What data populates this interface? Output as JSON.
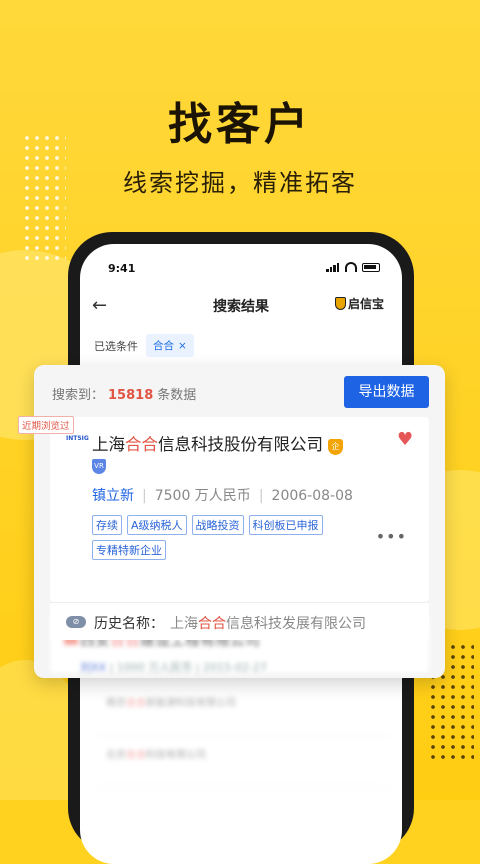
{
  "hero": {
    "title": "找客户",
    "subtitle": "线索挖掘，精准拓客"
  },
  "status_bar": {
    "time": "9:41"
  },
  "nav": {
    "back_icon": "←",
    "title": "搜索结果",
    "brand": "启信宝"
  },
  "filter": {
    "label": "已选条件",
    "chip": "合合",
    "chip_remove": "×"
  },
  "result_summary": {
    "prefix": "搜索到：",
    "count": "15818",
    "suffix": "条数据",
    "export_label": "导出数据"
  },
  "company": {
    "recent_badge": "近期浏览过",
    "logo_text": "INTSIG",
    "name_prefix": "上海",
    "name_highlight": "合合",
    "name_suffix": "信息科技股份有限公司",
    "gold_badge": "企",
    "vr_badge": "VR",
    "legal_person": "镇立新",
    "capital": "7500 万人民币",
    "founded": "2006-08-08",
    "tags": [
      "存续",
      "A级纳税人",
      "战略投资",
      "科创板已申报",
      "专精特新企业"
    ],
    "more": "•••",
    "history_label": "历史名称：",
    "history_prefix": "上海",
    "history_highlight": "合合",
    "history_suffix": "信息科技发展有限公司"
  },
  "blurred_card": {
    "name_prefix": "西安",
    "name_highlight": "合合",
    "name_suffix": "建设工程有限公司",
    "person": "刘XX",
    "capital": "1000 万人民币",
    "date": "2015-02-27"
  },
  "blurred_rows": [
    {
      "prefix": "南京",
      "hl": "合合",
      "suffix": "新能源科技有限公司"
    },
    {
      "prefix": "北京",
      "hl": "合合",
      "suffix": "科技有限公司"
    }
  ]
}
